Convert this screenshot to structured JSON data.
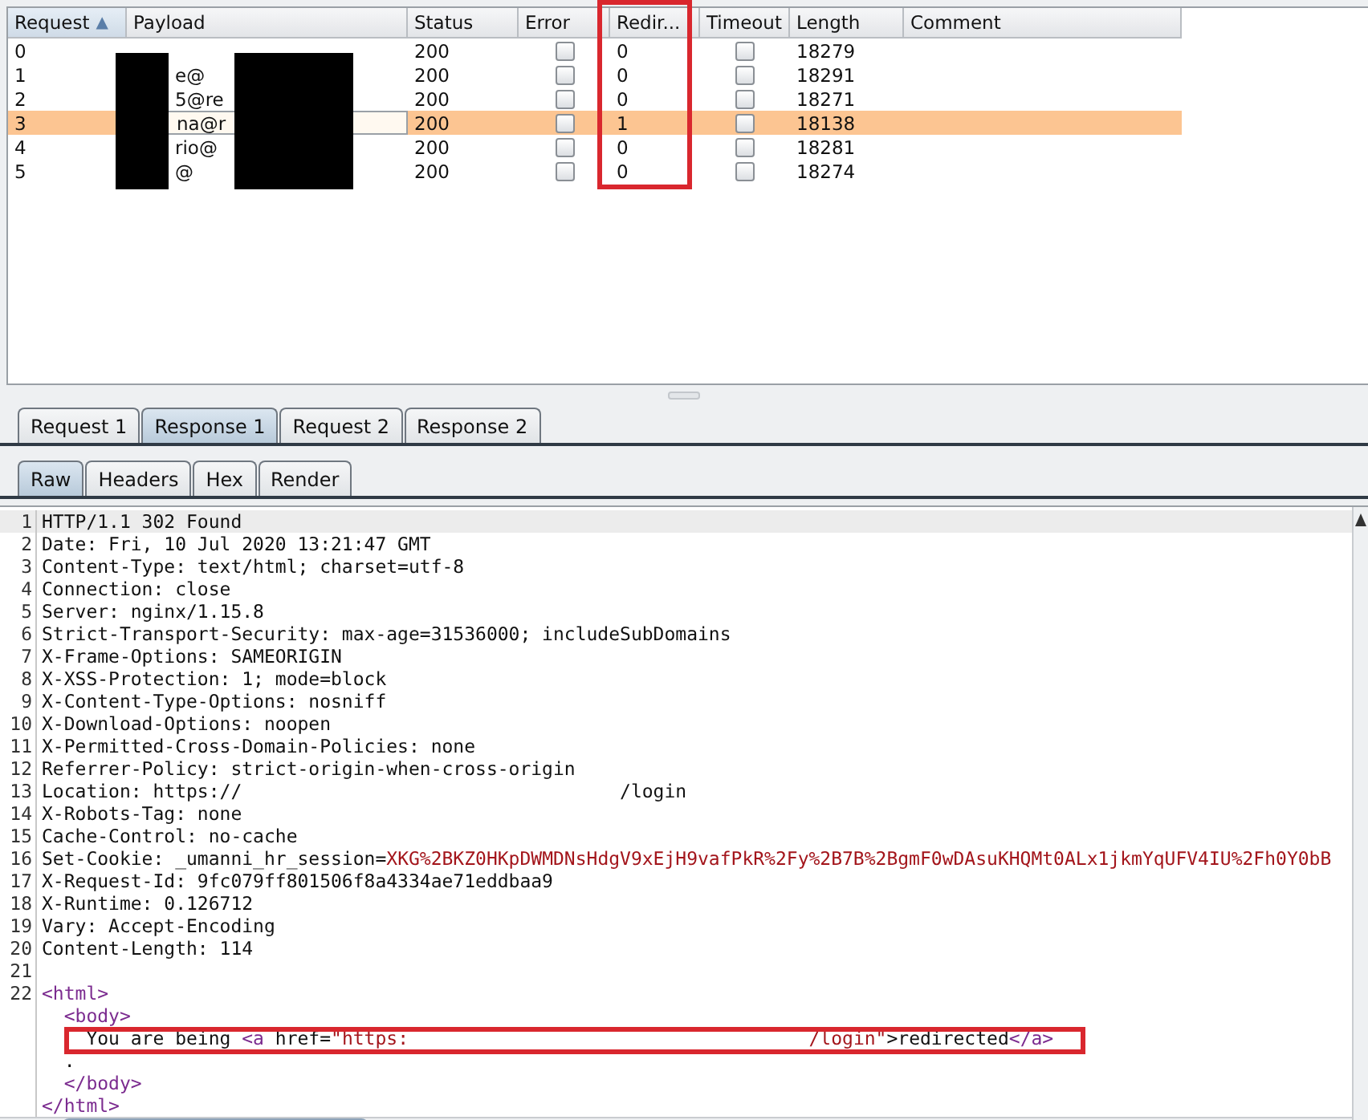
{
  "results_table": {
    "columns": [
      {
        "label": "Request",
        "sort_indicator": "▲"
      },
      {
        "label": "Payload"
      },
      {
        "label": "Status"
      },
      {
        "label": "Error"
      },
      {
        "label": "Redir..."
      },
      {
        "label": "Timeout"
      },
      {
        "label": "Length"
      },
      {
        "label": "Comment"
      }
    ],
    "rows": [
      {
        "request": "0",
        "status": "200",
        "error": false,
        "redirects": "0",
        "timeout": false,
        "length": "18279",
        "selected": false
      },
      {
        "request": "1",
        "payload": "e@",
        "status": "200",
        "error": false,
        "redirects": "0",
        "timeout": false,
        "length": "18291",
        "selected": false
      },
      {
        "request": "2",
        "payload": "5@re",
        "status": "200",
        "error": false,
        "redirects": "0",
        "timeout": false,
        "length": "18271",
        "selected": false
      },
      {
        "request": "3",
        "payload": "na@r",
        "status": "200",
        "error": false,
        "redirects": "1",
        "timeout": false,
        "length": "18138",
        "selected": true
      },
      {
        "request": "4",
        "payload": "rio@",
        "status": "200",
        "error": false,
        "redirects": "0",
        "timeout": false,
        "length": "18281",
        "selected": false
      },
      {
        "request": "5",
        "payload": "@",
        "status": "200",
        "error": false,
        "redirects": "0",
        "timeout": false,
        "length": "18274",
        "selected": false
      }
    ]
  },
  "message_tabs": [
    {
      "label": "Request 1",
      "selected": false
    },
    {
      "label": "Response 1",
      "selected": true
    },
    {
      "label": "Request 2",
      "selected": false
    },
    {
      "label": "Response 2",
      "selected": false
    }
  ],
  "view_tabs": [
    {
      "label": "Raw",
      "selected": true
    },
    {
      "label": "Headers",
      "selected": false
    },
    {
      "label": "Hex",
      "selected": false
    },
    {
      "label": "Render",
      "selected": false
    }
  ],
  "editor": {
    "lines": [
      {
        "number": "1",
        "current": true,
        "segments": [
          {
            "kind": "plain",
            "text": "HTTP/1.1 302 Found"
          }
        ]
      },
      {
        "number": "2",
        "current": false,
        "segments": [
          {
            "kind": "plain",
            "text": "Date: Fri, 10 Jul 2020 13:21:47 GMT"
          }
        ]
      },
      {
        "number": "3",
        "current": false,
        "segments": [
          {
            "kind": "plain",
            "text": "Content-Type: text/html; charset=utf-8"
          }
        ]
      },
      {
        "number": "4",
        "current": false,
        "segments": [
          {
            "kind": "plain",
            "text": "Connection: close"
          }
        ]
      },
      {
        "number": "5",
        "current": false,
        "segments": [
          {
            "kind": "plain",
            "text": "Server: nginx/1.15.8"
          }
        ]
      },
      {
        "number": "6",
        "current": false,
        "segments": [
          {
            "kind": "plain",
            "text": "Strict-Transport-Security: max-age=31536000; includeSubDomains"
          }
        ]
      },
      {
        "number": "7",
        "current": false,
        "segments": [
          {
            "kind": "plain",
            "text": "X-Frame-Options: SAMEORIGIN"
          }
        ]
      },
      {
        "number": "8",
        "current": false,
        "segments": [
          {
            "kind": "plain",
            "text": "X-XSS-Protection: 1; mode=block"
          }
        ]
      },
      {
        "number": "9",
        "current": false,
        "segments": [
          {
            "kind": "plain",
            "text": "X-Content-Type-Options: nosniff"
          }
        ]
      },
      {
        "number": "10",
        "current": false,
        "segments": [
          {
            "kind": "plain",
            "text": "X-Download-Options: noopen"
          }
        ]
      },
      {
        "number": "11",
        "current": false,
        "segments": [
          {
            "kind": "plain",
            "text": "X-Permitted-Cross-Domain-Policies: none"
          }
        ]
      },
      {
        "number": "12",
        "current": false,
        "segments": [
          {
            "kind": "plain",
            "text": "Referrer-Policy: strict-origin-when-cross-origin"
          }
        ]
      },
      {
        "number": "13",
        "current": false,
        "segments": [
          {
            "kind": "plain",
            "text": "Location: https://                                  /login"
          }
        ]
      },
      {
        "number": "14",
        "current": false,
        "segments": [
          {
            "kind": "plain",
            "text": "X-Robots-Tag: none"
          }
        ]
      },
      {
        "number": "15",
        "current": false,
        "segments": [
          {
            "kind": "plain",
            "text": "Cache-Control: no-cache"
          }
        ]
      },
      {
        "number": "16",
        "current": false,
        "segments": [
          {
            "kind": "plain",
            "text": "Set-Cookie: _umanni_hr_session="
          },
          {
            "kind": "value",
            "text": "XKG%2BKZ0HKpDWMDNsHdgV9xEjH9vafPkR%2Fy%2B7B%2BgmF0wDAsuKHQMt0ALx1jkmYqUFV4IU%2Fh0Y0bB"
          }
        ]
      },
      {
        "number": "17",
        "current": false,
        "segments": [
          {
            "kind": "plain",
            "text": "X-Request-Id: 9fc079ff801506f8a4334ae71eddbaa9"
          }
        ]
      },
      {
        "number": "18",
        "current": false,
        "segments": [
          {
            "kind": "plain",
            "text": "X-Runtime: 0.126712"
          }
        ]
      },
      {
        "number": "19",
        "current": false,
        "segments": [
          {
            "kind": "plain",
            "text": "Vary: Accept-Encoding"
          }
        ]
      },
      {
        "number": "20",
        "current": false,
        "segments": [
          {
            "kind": "plain",
            "text": "Content-Length: 114"
          }
        ]
      },
      {
        "number": "21",
        "current": false
      },
      {
        "number": "22",
        "current": false,
        "segments": [
          {
            "kind": "tag",
            "text": "<html>"
          }
        ]
      },
      {
        "current": false,
        "segments": [
          {
            "kind": "tag",
            "text": "  <body>"
          }
        ]
      },
      {
        "current": false,
        "highlighted": true,
        "segments": [
          {
            "kind": "plain",
            "text": "    You are being "
          },
          {
            "kind": "tag",
            "text": "<a"
          },
          {
            "kind": "plain",
            "text": " href="
          },
          {
            "kind": "value",
            "text": "\"https:                                    /login\""
          },
          {
            "kind": "plain",
            "text": ">redirected"
          },
          {
            "kind": "tag",
            "text": "</a>"
          }
        ]
      },
      {
        "current": false,
        "segments": [
          {
            "kind": "plain",
            "text": "  ."
          }
        ]
      },
      {
        "current": false,
        "segments": [
          {
            "kind": "tag",
            "text": "  </body>"
          }
        ]
      },
      {
        "current": false,
        "segments": [
          {
            "kind": "tag",
            "text": "</html>"
          }
        ]
      }
    ]
  }
}
